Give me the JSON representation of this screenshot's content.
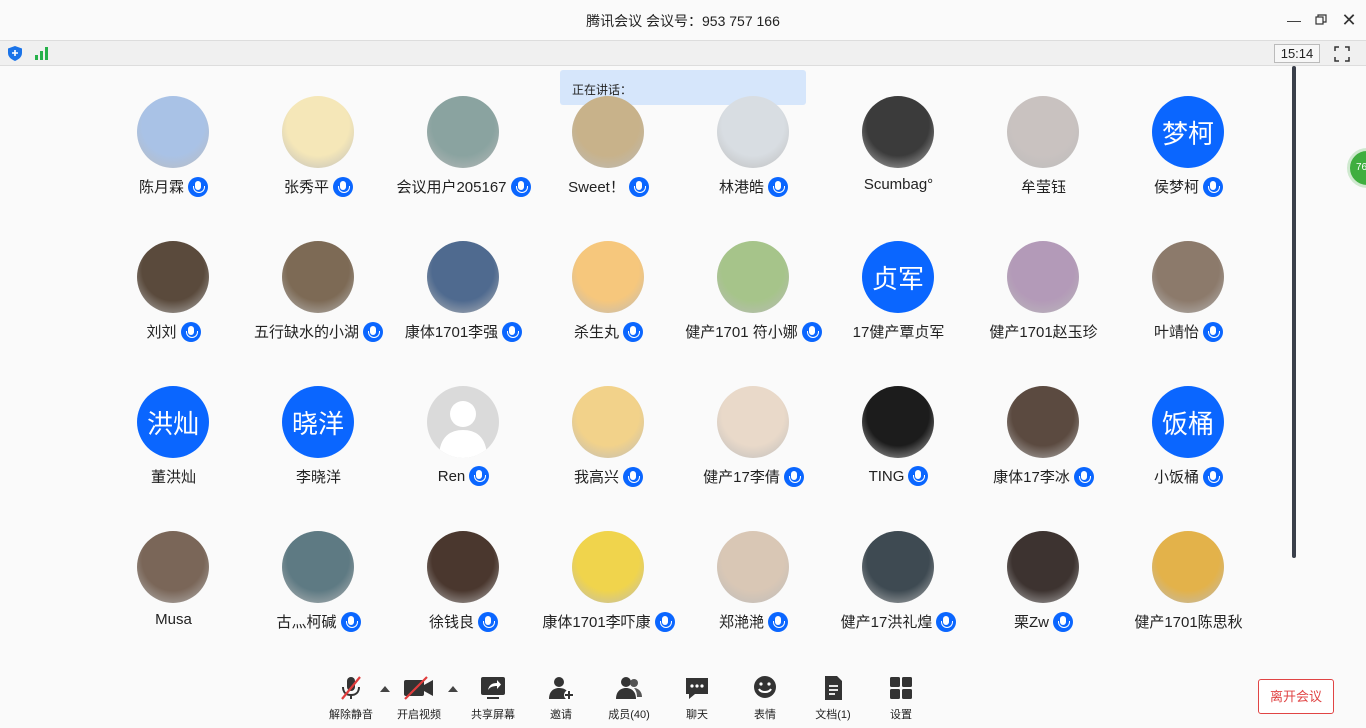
{
  "window": {
    "title": "腾讯会议 会议号：953 757 166"
  },
  "infobar": {
    "time": "15:14"
  },
  "speaking_label": "正在讲话：",
  "side_badge": "76",
  "participants": [
    {
      "name": "陈月霖",
      "mic": true,
      "avatar": "photo",
      "color": "#a9c2e6"
    },
    {
      "name": "张秀平",
      "mic": true,
      "avatar": "photo",
      "color": "#f5e7b8"
    },
    {
      "name": "会议用户205167",
      "mic": true,
      "avatar": "photo",
      "color": "#8aa3a0"
    },
    {
      "name": "Sweet！",
      "mic": true,
      "avatar": "photo",
      "color": "#c8b28a"
    },
    {
      "name": "林港皓",
      "mic": true,
      "avatar": "photo",
      "color": "#d8dde2"
    },
    {
      "name": "Scumbag°",
      "mic": false,
      "avatar": "photo",
      "color": "#3b3b3b"
    },
    {
      "name": "牟莹钰",
      "mic": false,
      "avatar": "photo",
      "color": "#c9c2c0"
    },
    {
      "name": "侯梦柯",
      "mic": true,
      "avatar": "letters",
      "letters": "梦柯"
    },
    {
      "name": "刘刘",
      "mic": true,
      "avatar": "photo",
      "color": "#5a4a3c"
    },
    {
      "name": "五行缺水的小湖",
      "mic": true,
      "avatar": "photo",
      "color": "#7d6a55"
    },
    {
      "name": "康体1701李强",
      "mic": true,
      "avatar": "photo",
      "color": "#4f6a8f"
    },
    {
      "name": "杀生丸",
      "mic": true,
      "avatar": "photo",
      "color": "#f6c77c"
    },
    {
      "name": "健产1701 符小娜",
      "mic": true,
      "avatar": "photo",
      "color": "#a6c48a"
    },
    {
      "name": "17健产覃贞军",
      "mic": false,
      "avatar": "letters",
      "letters": "贞军"
    },
    {
      "name": "健产1701赵玉珍",
      "mic": false,
      "avatar": "photo",
      "color": "#b39ab8"
    },
    {
      "name": "叶靖怡",
      "mic": true,
      "avatar": "photo",
      "color": "#8c7a6b"
    },
    {
      "name": "董洪灿",
      "mic": false,
      "avatar": "letters",
      "letters": "洪灿"
    },
    {
      "name": "李晓洋",
      "mic": false,
      "avatar": "letters",
      "letters": "晓洋"
    },
    {
      "name": "Ren",
      "mic": true,
      "avatar": "default"
    },
    {
      "name": "我高兴",
      "mic": true,
      "avatar": "photo",
      "color": "#f2d28a"
    },
    {
      "name": "健产17李倩",
      "mic": true,
      "avatar": "photo",
      "color": "#e9d9c9"
    },
    {
      "name": "TING",
      "mic": true,
      "avatar": "photo",
      "color": "#1c1c1c"
    },
    {
      "name": "康体17李冰",
      "mic": true,
      "avatar": "photo",
      "color": "#5b4a40"
    },
    {
      "name": "小饭桶",
      "mic": true,
      "avatar": "letters",
      "letters": "饭桶"
    },
    {
      "name": "Musa",
      "mic": false,
      "avatar": "photo",
      "color": "#7a6658"
    },
    {
      "name": "古灬柯碱",
      "mic": true,
      "avatar": "photo",
      "color": "#5e7a83"
    },
    {
      "name": "徐钱良",
      "mic": true,
      "avatar": "photo",
      "color": "#4a372e"
    },
    {
      "name": "康体1701李吓康",
      "mic": true,
      "avatar": "photo",
      "color": "#f0d44c"
    },
    {
      "name": "郑滟滟",
      "mic": true,
      "avatar": "photo",
      "color": "#d9c7b5"
    },
    {
      "name": "健产17洪礼煌",
      "mic": true,
      "avatar": "photo",
      "color": "#3e4a52"
    },
    {
      "name": "栗Zw",
      "mic": true,
      "avatar": "photo",
      "color": "#3d3330"
    },
    {
      "name": "健产1701陈思秋",
      "mic": false,
      "avatar": "photo",
      "color": "#e3b24a"
    }
  ],
  "toolbar": {
    "mute": "解除静音",
    "video": "开启视频",
    "share": "共享屏幕",
    "invite": "邀请",
    "members": "成员(40)",
    "chat": "聊天",
    "emoji": "表情",
    "docs": "文档(1)",
    "settings": "设置"
  },
  "leave_label": "离开会议"
}
